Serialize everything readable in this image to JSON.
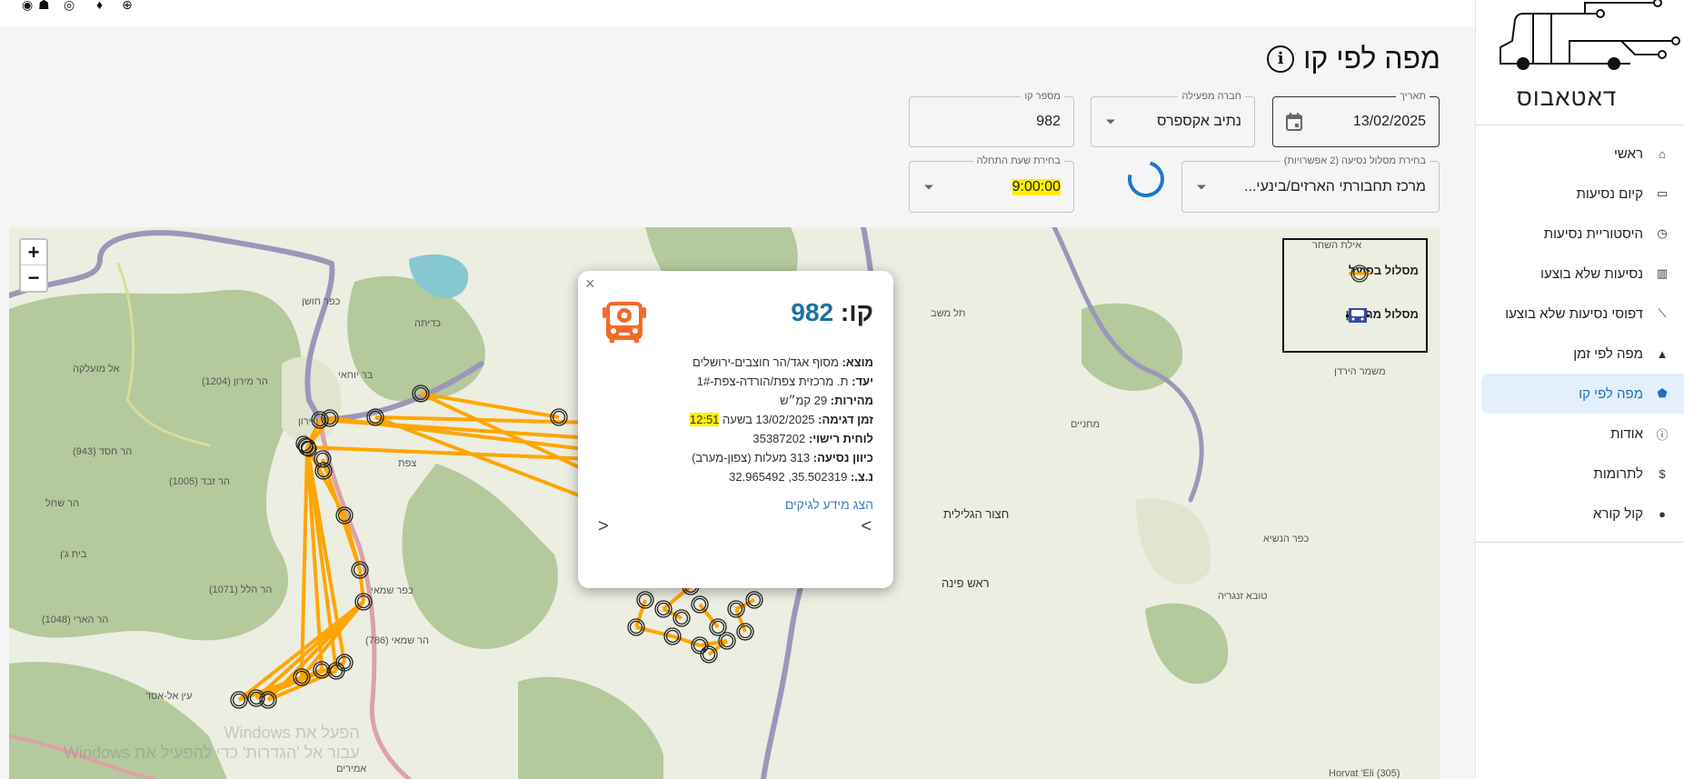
{
  "topbar": {
    "icons": [
      "github-icon",
      "bug-icon",
      "target-icon",
      "lightbulb-icon",
      "globe-icon"
    ]
  },
  "sidebar": {
    "logo_text": "דאטאבוס",
    "items": [
      {
        "label": "ראשי",
        "icon": "home-icon",
        "glyph": "⌂"
      },
      {
        "label": "קיום נסיעות",
        "icon": "laptop-icon",
        "glyph": "▭"
      },
      {
        "label": "היסטוריית נסיעות",
        "icon": "history-icon",
        "glyph": "◷"
      },
      {
        "label": "נסיעות שלא בוצעו",
        "icon": "bar-chart-icon",
        "glyph": "▥"
      },
      {
        "label": "דפוסי נסיעות שלא בוצעו",
        "icon": "line-chart-icon",
        "glyph": "⟋"
      },
      {
        "label": "מפה לפי זמן",
        "icon": "heatmap-icon",
        "glyph": "▲"
      },
      {
        "label": "מפה לפי קו",
        "icon": "radar-icon",
        "glyph": "⬟",
        "active": true
      },
      {
        "label": "אודות",
        "icon": "info-icon",
        "glyph": "ⓘ"
      },
      {
        "label": "לתרומות",
        "icon": "dollar-icon",
        "glyph": "$"
      },
      {
        "label": "קול קורא",
        "icon": "bulb-icon",
        "glyph": "●"
      }
    ]
  },
  "page": {
    "title": "מפה לפי קו",
    "info_glyph": "i"
  },
  "form": {
    "date": {
      "label": "תאריך",
      "value": "13/02/2025"
    },
    "operator": {
      "label": "חברה מפעילה",
      "value": "נתיב אקספרס"
    },
    "line": {
      "label": "מספר קו",
      "value": "982"
    },
    "route": {
      "label": "בחירת מסלול נסיעה (2 אפשרויות)",
      "value": "מרכז תחבורתי הארזים/בינעי..."
    },
    "start_time": {
      "label": "בחירת שעת התחלה",
      "value": "9:00:00"
    }
  },
  "map": {
    "zoom_in": "+",
    "zoom_out": "−",
    "legend": {
      "actual": "מסלול בפועל",
      "planned": "מסלול מתוכנן"
    },
    "colors": {
      "route": "#ffa500",
      "forest": "#b4c99c",
      "road": "#9d96b9",
      "road2": "#dba2a8"
    },
    "labels": [
      "מירון",
      "בר יוחאי",
      "כפר חושן",
      "כדיתה",
      "הר מירון (1204)",
      "הר חסד (943)",
      "הר זבד (1005)",
      "הר שחל",
      "בית ג'ן",
      "הר הלל (1071)",
      "הר הארי (1048)",
      "הר שמאי (786)",
      "כפר שמאי",
      "צפת",
      "אל מועלקה",
      "חצור הגלילית",
      "ראש פינה",
      "כפר הנשיא",
      "טובא זנגריה",
      "משמר הירדן",
      "מחניים",
      "תל משב",
      "אילת השחר",
      "Horvat 'Eli (305)",
      "עין אל-אסד",
      "אמירים"
    ],
    "watermark": [
      "הפעל את Windows",
      "עבור אל 'הגדרות' כדי להפעיל את Windows"
    ]
  },
  "popup": {
    "title_prefix": "קו:",
    "line": "982",
    "rows": [
      {
        "label": "מוצא:",
        "value": "מסוף אגד/הר חוצבים-ירושלים"
      },
      {
        "label": "יעד:",
        "value": "ת. מרכזית צפת/הורדה-צפת-1#"
      },
      {
        "label": "מהירות:",
        "value": "29 קמ״ש"
      },
      {
        "label": "זמן דגימה:",
        "value": "13/02/2025 בשעה ",
        "highlight": "12:51"
      },
      {
        "label": "לוחית רישוי:",
        "value": "35387202"
      },
      {
        "label": "כיוון נסיעה:",
        "value": "313 מעלות (צפון-מערב)"
      },
      {
        "label": "נ.צ.:",
        "value": "35.502319, 32.965492"
      }
    ],
    "link": "הצג מידע לגיקים",
    "prev": "<",
    "next": ">",
    "close": "×"
  }
}
